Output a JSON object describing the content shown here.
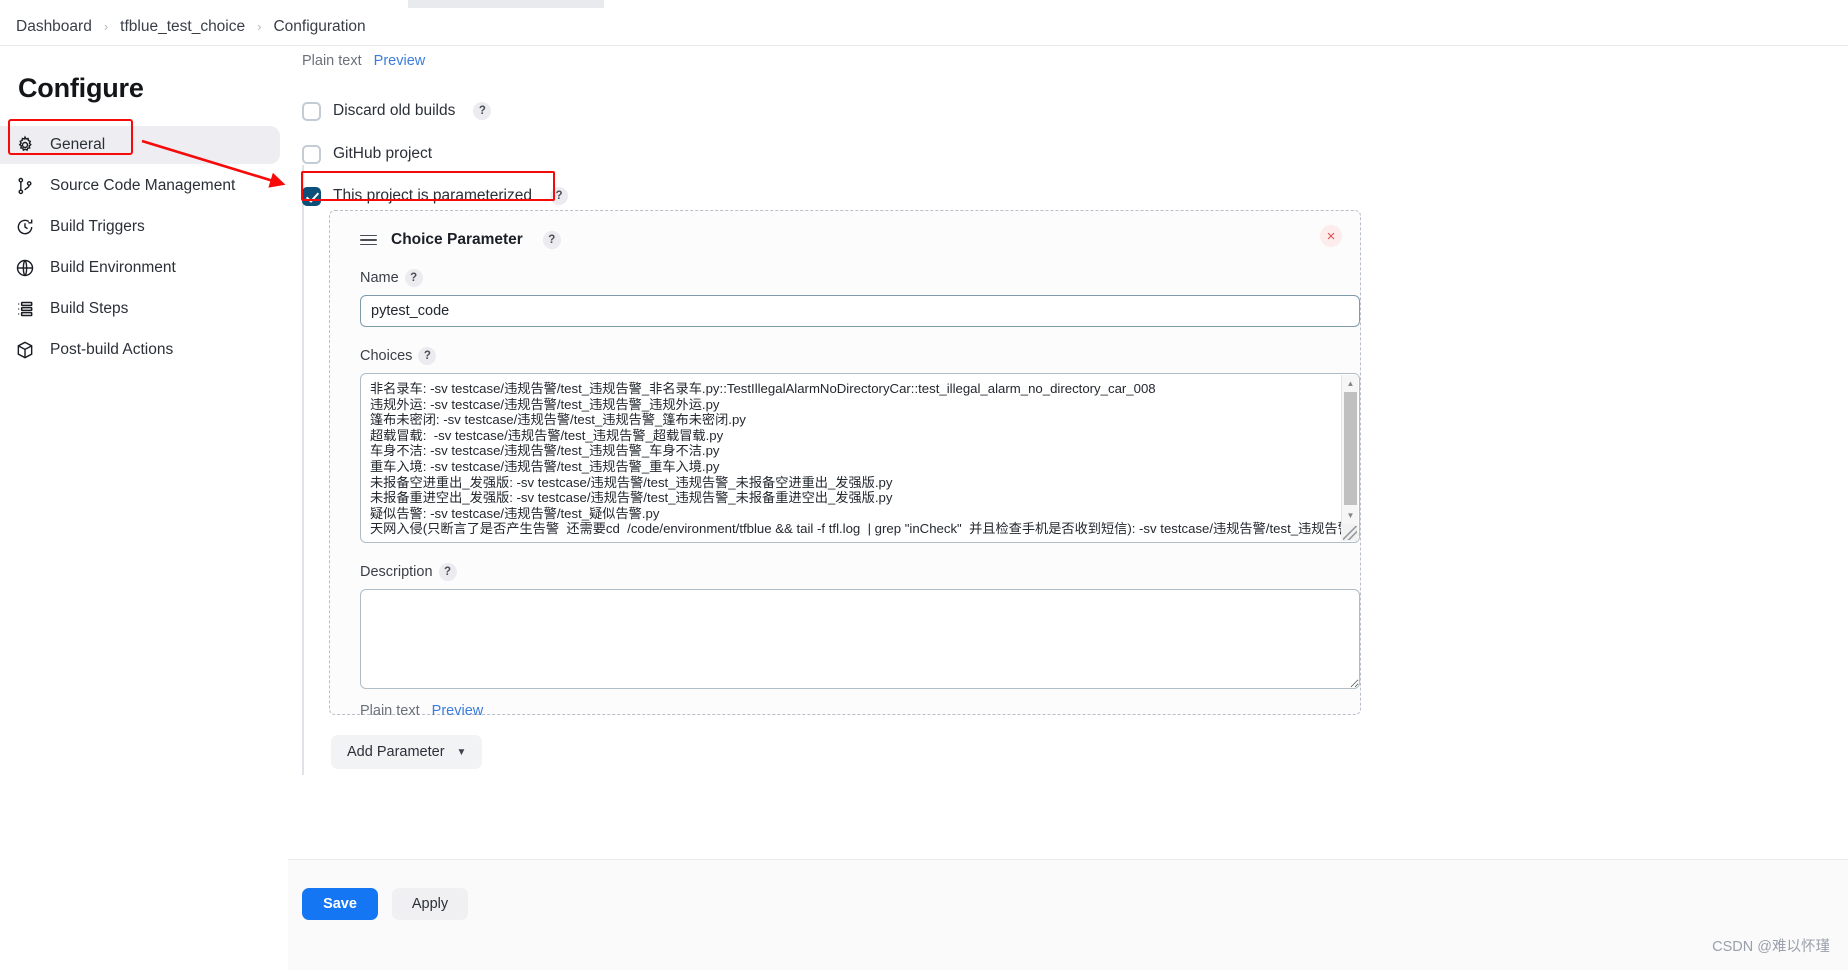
{
  "breadcrumb": {
    "items": [
      "Dashboard",
      "tfblue_test_choice",
      "Configuration"
    ],
    "separator": "›"
  },
  "sidebar": {
    "title": "Configure",
    "items": [
      {
        "label": "General",
        "icon": "gear-icon",
        "active": true
      },
      {
        "label": "Source Code Management",
        "icon": "branch-icon",
        "active": false
      },
      {
        "label": "Build Triggers",
        "icon": "clock-icon",
        "active": false
      },
      {
        "label": "Build Environment",
        "icon": "globe-icon",
        "active": false
      },
      {
        "label": "Build Steps",
        "icon": "list-icon",
        "active": false
      },
      {
        "label": "Post-build Actions",
        "icon": "package-icon",
        "active": false
      }
    ]
  },
  "main": {
    "top_markup": {
      "plain_text_label": "Plain text",
      "preview_label": "Preview"
    },
    "checkboxes": [
      {
        "label": "Discard old builds",
        "checked": false,
        "help": "?"
      },
      {
        "label": "GitHub project",
        "checked": false,
        "help": null
      },
      {
        "label": "This project is parameterized",
        "checked": true,
        "help": "?"
      }
    ],
    "parameter": {
      "title": "Choice Parameter",
      "title_help": "?",
      "close_label": "×",
      "name_label": "Name",
      "name_help": "?",
      "name_value": "pytest_code",
      "choices_label": "Choices",
      "choices_help": "?",
      "choices_value": "非名录车: -sv testcase/违规告警/test_违规告警_非名录车.py::TestIllegalAlarmNoDirectoryCar::test_illegal_alarm_no_directory_car_008\n违规外运: -sv testcase/违规告警/test_违规告警_违规外运.py\n篷布未密闭: -sv testcase/违规告警/test_违规告警_篷布未密闭.py\n超载冒载:  -sv testcase/违规告警/test_违规告警_超载冒载.py\n车身不洁: -sv testcase/违规告警/test_违规告警_车身不洁.py\n重车入境: -sv testcase/违规告警/test_违规告警_重车入境.py\n未报备空进重出_发强版: -sv testcase/违规告警/test_违规告警_未报备空进重出_发强版.py\n未报备重进空出_发强版: -sv testcase/违规告警/test_违规告警_未报备重进空出_发强版.py\n疑似告警: -sv testcase/违规告警/test_疑似告警.py\n天网入侵(只断言了是否产生告警  还需要cd  /code/environment/tfblue && tail -f tfl.log  | grep \"inCheck\"  并且检查手机是否收到短信): -sv testcase/违规告警/test_违规告警_天网入侵.py",
      "description_label": "Description",
      "description_help": "?",
      "description_value": "",
      "description_placeholder": "",
      "footer_plain_text": "Plain text",
      "footer_preview": "Preview"
    },
    "add_parameter_label": "Add Parameter",
    "add_parameter_chevron": "⌄"
  },
  "bottom": {
    "save_label": "Save",
    "apply_label": "Apply"
  },
  "watermark": "CSDN @难以怀瑾",
  "colors": {
    "accent_blue": "#1576f3",
    "link_blue": "#3b7ddd",
    "checkbox_checked": "#0b4f7a",
    "annotation_red": "#f60b0b",
    "sidebar_active_bg": "#eeeef2"
  }
}
